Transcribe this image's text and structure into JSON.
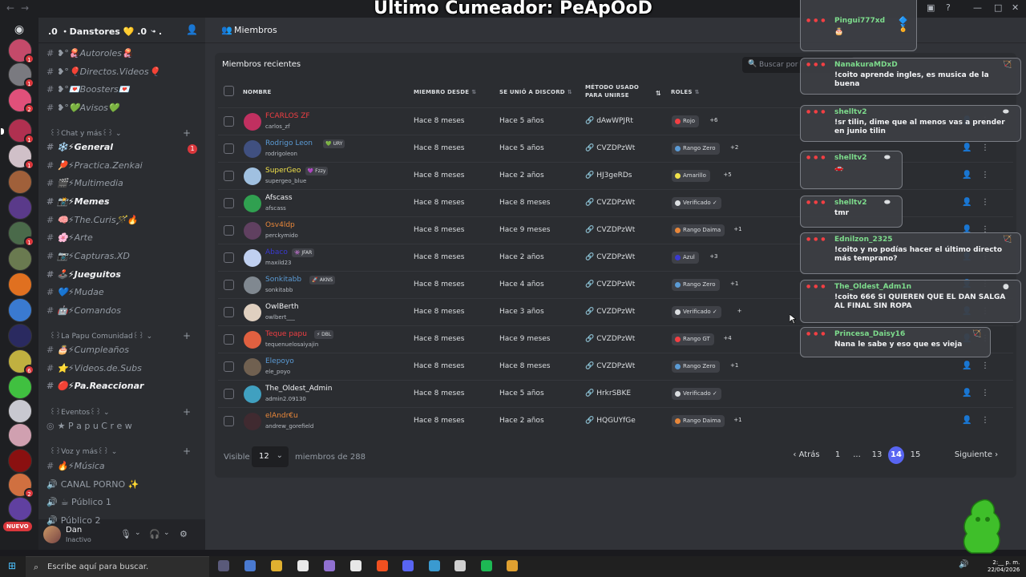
{
  "overlay_title": "Último Cumeador: PeApOoD",
  "server": {
    "name": ".0 ・Danstores 💛 .0 ・.",
    "icons": [
      {
        "badge": "1",
        "color": "#c44a6a"
      },
      {
        "badge": "1",
        "color": "#7a7a80"
      },
      {
        "badge": "2",
        "color": "#e0507a"
      },
      {
        "badge": "1",
        "color": "#b03050"
      },
      {
        "badge": "1",
        "color": "#d0c0c8"
      },
      {
        "badge": "",
        "color": "#a0603a"
      },
      {
        "badge": "",
        "color": "#5a3a8a"
      },
      {
        "badge": "1",
        "color": "#4a6a4a"
      },
      {
        "badge": "",
        "color": "#6a7a50"
      },
      {
        "badge": "",
        "color": "#e07020"
      },
      {
        "badge": "",
        "color": "#3a7ad0"
      },
      {
        "badge": "",
        "color": "#2a2a60"
      },
      {
        "badge": "6",
        "color": "#c0b040"
      },
      {
        "badge": "",
        "color": "#40c040"
      },
      {
        "badge": "",
        "color": "#c8c8d0"
      },
      {
        "badge": "",
        "color": "#d0a0b0"
      },
      {
        "badge": "",
        "color": "#8a1010"
      },
      {
        "badge": "2",
        "color": "#d07040"
      },
      {
        "badge": "",
        "color": "#6040a0"
      }
    ],
    "new_label": "NUEVO"
  },
  "channels": {
    "items": [
      {
        "label": "❥°🪼Autoroles🪼",
        "top": 0
      },
      {
        "label": "❥°🎈Directos.Videos🎈",
        "top": 0
      },
      {
        "label": "❥°💌Boosters💌",
        "top": 0
      },
      {
        "label": "❥°💚Avisos💚",
        "top": 0
      }
    ],
    "cat_chat": "꒰꒱Chat y más꒰꒱",
    "chat_items": [
      {
        "label": "❄️⚡General",
        "bold": true,
        "badge": "1"
      },
      {
        "label": "🏓⚡Practica.Zenkai",
        "bold": false,
        "badge": ""
      },
      {
        "label": "🎬⚡Multimedia",
        "bold": false,
        "badge": ""
      },
      {
        "label": "📸⚡Memes",
        "bold": true,
        "badge": ""
      },
      {
        "label": "🧠⚡The.Curis🪄🔥",
        "bold": false,
        "badge": ""
      },
      {
        "label": "🌸⚡Arte",
        "bold": false,
        "badge": ""
      },
      {
        "label": "📷⚡Capturas.XD",
        "bold": false,
        "badge": ""
      },
      {
        "label": "🕹️⚡Jueguitos",
        "bold": true,
        "badge": ""
      },
      {
        "label": "💙⚡Mudae",
        "bold": false,
        "badge": ""
      },
      {
        "label": "🤖⚡Comandos",
        "bold": false,
        "badge": ""
      }
    ],
    "cat_papu": "꒰꒱La Papu Comunidad꒰꒱",
    "papu_items": [
      {
        "label": "🎂⚡Cumpleaños",
        "bold": false
      },
      {
        "label": "⭐⚡Videos.de.Subs",
        "bold": false
      },
      {
        "label": "🔴⚡Pa.Reaccionar",
        "bold": true
      }
    ],
    "cat_events": "꒰꒱Eventos꒰꒱",
    "event_item": "★ P a p u C r e w",
    "cat_voice": "꒰꒱Voz y más꒰꒱",
    "voice_items": [
      "🔥⚡Música",
      "CANAL PORNO ✨",
      "☕ Público 1",
      "Público 2"
    ]
  },
  "user": {
    "name": "Dan",
    "status": "Inactivo"
  },
  "main": {
    "header": "Miembros",
    "panel_title": "Miembros recientes",
    "search_placeholder": "Buscar por n",
    "columns": [
      "NOMBRE",
      "MIEMBRO DESDE",
      "SE UNIÓ A DISCORD",
      "MÉTODO USADO PARA UNIRSE",
      "ROLES"
    ],
    "rows": [
      {
        "name": "FCARLOS ZF",
        "user": "carlos_zf",
        "name_color": "#f23f43",
        "tag": "",
        "member": "Hace 8 meses",
        "joined": "Hace 5 años",
        "invite": "dAwWPJRt",
        "role": "Rojo",
        "role_color": "#f23f43",
        "more": "+6",
        "avatar": "#c03060"
      },
      {
        "name": "Rodrigo Leon",
        "user": "rodrigoleon",
        "name_color": "#5b9bd5",
        "tag": "💚 URY",
        "member": "Hace 8 meses",
        "joined": "Hace 5 años",
        "invite": "CVZDPzWt",
        "role": "Rango Zero",
        "role_color": "#5b9bd5",
        "more": "+2",
        "avatar": "#405080"
      },
      {
        "name": "SuperGeo",
        "user": "supergeo_blue",
        "name_color": "#f0e14a",
        "tag": "💜 Fzzy",
        "member": "Hace 8 meses",
        "joined": "Hace 2 años",
        "invite": "HJ3geRDs",
        "role": "Amarillo",
        "role_color": "#f0e14a",
        "more": "+5",
        "avatar": "#a0c0e0"
      },
      {
        "name": "Afscass",
        "user": "afscass",
        "name_color": "#f2f3f5",
        "tag": "",
        "member": "Hace 8 meses",
        "joined": "Hace 8 meses",
        "invite": "CVZDPzWt",
        "role": "Verificado ✓",
        "role_color": "#dbdee1",
        "more": "",
        "avatar": "#30a050"
      },
      {
        "name": "Osv4ldp",
        "user": "perckymido",
        "name_color": "#e8873a",
        "tag": "",
        "member": "Hace 8 meses",
        "joined": "Hace 9 meses",
        "invite": "CVZDPzWt",
        "role": "Rango Daima",
        "role_color": "#e8873a",
        "more": "+1",
        "avatar": "#604060"
      },
      {
        "name": "Abaco",
        "user": "maxild23",
        "name_color": "#3a3ad0",
        "tag": "👾 JFAR",
        "member": "Hace 8 meses",
        "joined": "Hace 2 años",
        "invite": "CVZDPzWt",
        "role": "Azul",
        "role_color": "#3a3ad0",
        "more": "+3",
        "avatar": "#c0d0f0"
      },
      {
        "name": "Sonkitabb",
        "user": "sonkitabb",
        "name_color": "#5b9bd5",
        "tag": "🚀 AKNS",
        "member": "Hace 8 meses",
        "joined": "Hace 4 años",
        "invite": "CVZDPzWt",
        "role": "Rango Zero",
        "role_color": "#5b9bd5",
        "more": "+1",
        "avatar": "#808890"
      },
      {
        "name": "OwlBerth",
        "user": "owlbert___",
        "name_color": "#f2f3f5",
        "tag": "",
        "member": "Hace 8 meses",
        "joined": "Hace 3 años",
        "invite": "CVZDPzWt",
        "role": "Verificado ✓",
        "role_color": "#dbdee1",
        "more": "+",
        "avatar": "#e0d0c0"
      },
      {
        "name": "Teque papu",
        "user": "tequenuelosaiyajin",
        "name_color": "#f23f43",
        "tag": "⚡ DBL",
        "member": "Hace 8 meses",
        "joined": "Hace 9 meses",
        "invite": "CVZDPzWt",
        "role": "Rango GT",
        "role_color": "#f23f43",
        "more": "+4",
        "avatar": "#e06040"
      },
      {
        "name": "Elepoyo",
        "user": "ele_poyo",
        "name_color": "#5b9bd5",
        "tag": "",
        "member": "Hace 8 meses",
        "joined": "Hace 8 meses",
        "invite": "CVZDPzWt",
        "role": "Rango Zero",
        "role_color": "#5b9bd5",
        "more": "+1",
        "avatar": "#706050"
      },
      {
        "name": "The_Oldest_Admin",
        "user": "admin2.09130",
        "name_color": "#f2f3f5",
        "tag": "",
        "member": "Hace 8 meses",
        "joined": "Hace 5 años",
        "invite": "HrkrSBKE",
        "role": "Verificado ✓",
        "role_color": "#dbdee1",
        "more": "",
        "avatar": "#40a0c0"
      },
      {
        "name": "elAndr€u",
        "user": "andrew_gorefield",
        "name_color": "#e8873a",
        "tag": "",
        "member": "Hace 8 meses",
        "joined": "Hace 2 años",
        "invite": "HQGUYfGe",
        "role": "Rango Daima",
        "role_color": "#e8873a",
        "more": "+1",
        "avatar": "#402a30"
      }
    ],
    "footer": {
      "visible_label": "Visible",
      "per_page": "12",
      "of_label": "miembros de 288",
      "prev": "‹ Atrás",
      "pages": [
        "1",
        "...",
        "13",
        "14",
        "15"
      ],
      "current": "14",
      "next": "Siguiente ›"
    }
  },
  "chat_overlay": [
    {
      "user": "Pingui777xd",
      "text": "🎂",
      "badge": "🔷🏅"
    },
    {
      "user": "NanakuraMDxD",
      "text": "!coito aprende ingles, es musica de la buena",
      "badge": "🏹"
    },
    {
      "user": "shelltv2",
      "text": "!sr tilin, dime que al menos vas a prender en junio tilin",
      "badge": "⬬"
    },
    {
      "user": "shelltv2",
      "text": "🚗",
      "badge": "⬬"
    },
    {
      "user": "shelltv2",
      "text": "tmr",
      "badge": "⬬"
    },
    {
      "user": "Ednilzon_2325",
      "text": "!coito y no podías hacer el último directo más temprano?",
      "badge": "🏹"
    },
    {
      "user": "The_Oldest_Adm1n",
      "text": "!coito 666 SI QUIEREN QUE EL DAN SALGA AL FINAL SIN ROPA",
      "badge": "●"
    },
    {
      "user": "Princesa_Daisy16",
      "text": "Nana le sabe y eso que es vieja",
      "badge": "🏹"
    }
  ],
  "taskbar": {
    "search_text": "Escribe aquí para buscar.",
    "time": "2:__ p. m.",
    "date": "22/04/2026"
  }
}
